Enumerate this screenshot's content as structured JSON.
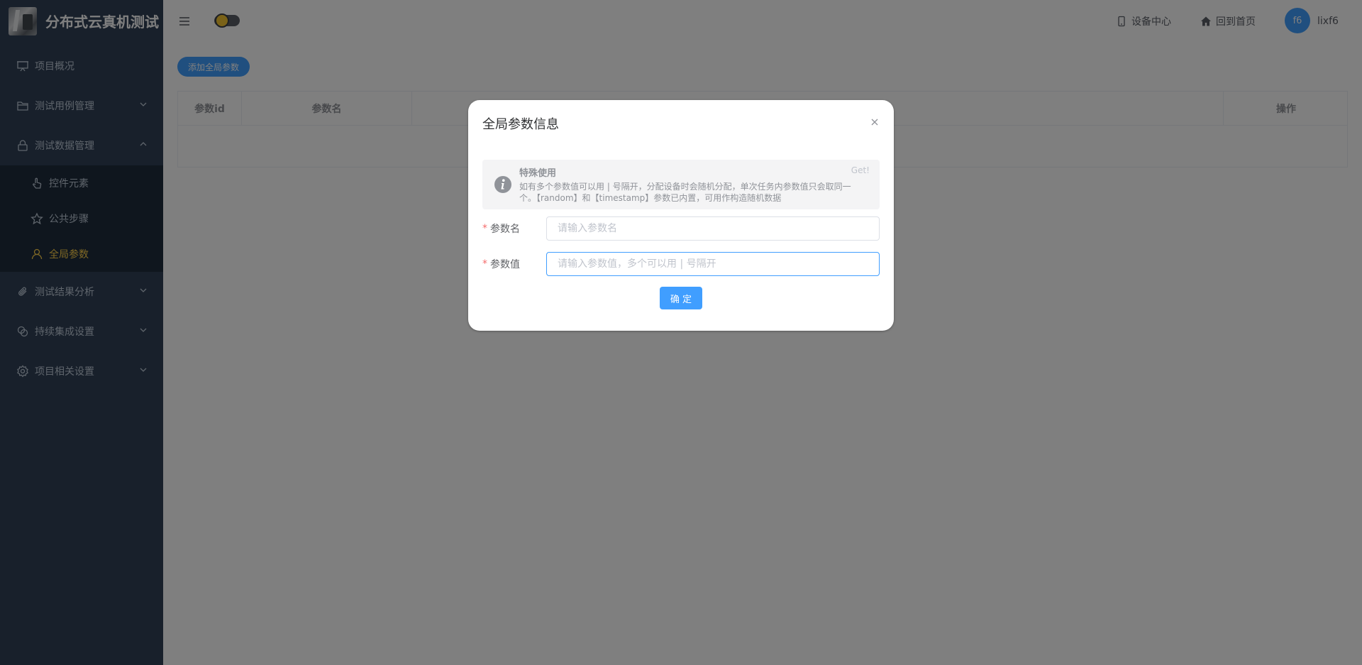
{
  "app": {
    "title": "分布式云真机测试"
  },
  "sidebar": {
    "items": [
      {
        "label": "项目概况"
      },
      {
        "label": "测试用例管理"
      },
      {
        "label": "测试数据管理"
      },
      {
        "label": "控件元素"
      },
      {
        "label": "公共步骤"
      },
      {
        "label": "全局参数"
      },
      {
        "label": "测试结果分析"
      },
      {
        "label": "持续集成设置"
      },
      {
        "label": "项目相关设置"
      }
    ],
    "active_color": "#ffd04b"
  },
  "header": {
    "device_center": "设备中心",
    "back_home": "回到首页",
    "avatar_text": "f6",
    "username": "lixf6"
  },
  "main": {
    "add_button": "添加全局参数",
    "table": {
      "columns": [
        "参数id",
        "参数名",
        "",
        "操作"
      ]
    }
  },
  "dialog": {
    "title": "全局参数信息",
    "alert": {
      "title": "特殊使用",
      "description": "如有多个参数值可以用 | 号隔开，分配设备时会随机分配，单次任务内参数值只会取同一个。【random】和【timestamp】参数已内置，可用作构造随机数据",
      "close_text": "Get!"
    },
    "fields": [
      {
        "label": "参数名",
        "placeholder": "请输入参数名",
        "value": ""
      },
      {
        "label": "参数值",
        "placeholder": "请输入参数值，多个可以用 | 号隔开",
        "value": ""
      }
    ],
    "confirm": "确 定"
  },
  "colors": {
    "primary": "#409eff",
    "sidebar": "#304156"
  }
}
